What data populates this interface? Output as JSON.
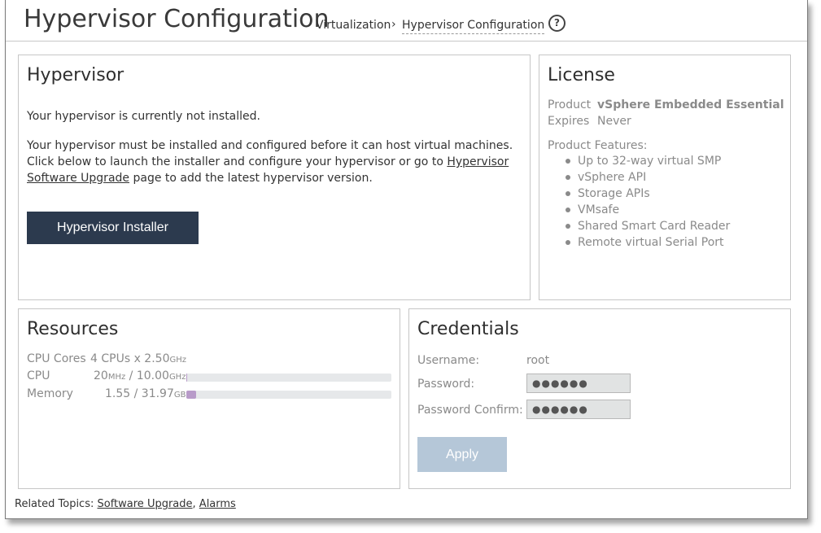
{
  "header": {
    "title": "Hypervisor Configuration",
    "breadcrumb": [
      "Virtualization",
      "Hypervisor Configuration"
    ],
    "breadcrumb_separator": "›",
    "help_icon": "?"
  },
  "hypervisor": {
    "heading": "Hypervisor",
    "status_text": "Your hypervisor is currently not installed.",
    "desc_before": "Your hypervisor must be installed and configured before it can host virtual machines. Click below to launch the installer and configure your hypervisor or go to ",
    "desc_link": "Hypervisor Software Upgrade",
    "desc_after": " page to add the latest hypervisor version.",
    "installer_button": "Hypervisor Installer",
    "button_color": "#2c3a4e"
  },
  "license": {
    "heading": "License",
    "product_label": "Product",
    "product_value": "vSphere Embedded Essential",
    "expires_label": "Expires",
    "expires_value": "Never",
    "features_label": "Product Features:",
    "features": [
      "Up to 32-way virtual SMP",
      "vSphere API",
      "Storage APIs",
      "VMsafe",
      "Shared Smart Card Reader",
      "Remote virtual Serial Port"
    ]
  },
  "resources": {
    "heading": "Resources",
    "cpu_cores_label": "CPU Cores",
    "cpu_cores_count": "4 CPUs x 2.50",
    "cpu_cores_unit": "GHz",
    "cpu_label": "CPU",
    "cpu_used": "20",
    "cpu_used_unit": "MHz",
    "cpu_total": " / 10.00",
    "cpu_total_unit": "GHz",
    "cpu_fraction": 0.002,
    "memory_label": "Memory",
    "memory_value": "1.55 / 31.97",
    "memory_unit": "GB",
    "memory_fraction": 0.0485,
    "memory_bar_color": "#b89bc9"
  },
  "credentials": {
    "heading": "Credentials",
    "username_label": "Username:",
    "username_value": "root",
    "password_label": "Password:",
    "password_value": "●●●●●●",
    "password_confirm_label": "Password Confirm:",
    "password_confirm_value": "●●●●●●",
    "apply_button": "Apply",
    "apply_color": "#b5c7d8"
  },
  "footer": {
    "prefix": "Related Topics: ",
    "links": [
      "Software Upgrade",
      "Alarms"
    ],
    "separator": ", "
  }
}
